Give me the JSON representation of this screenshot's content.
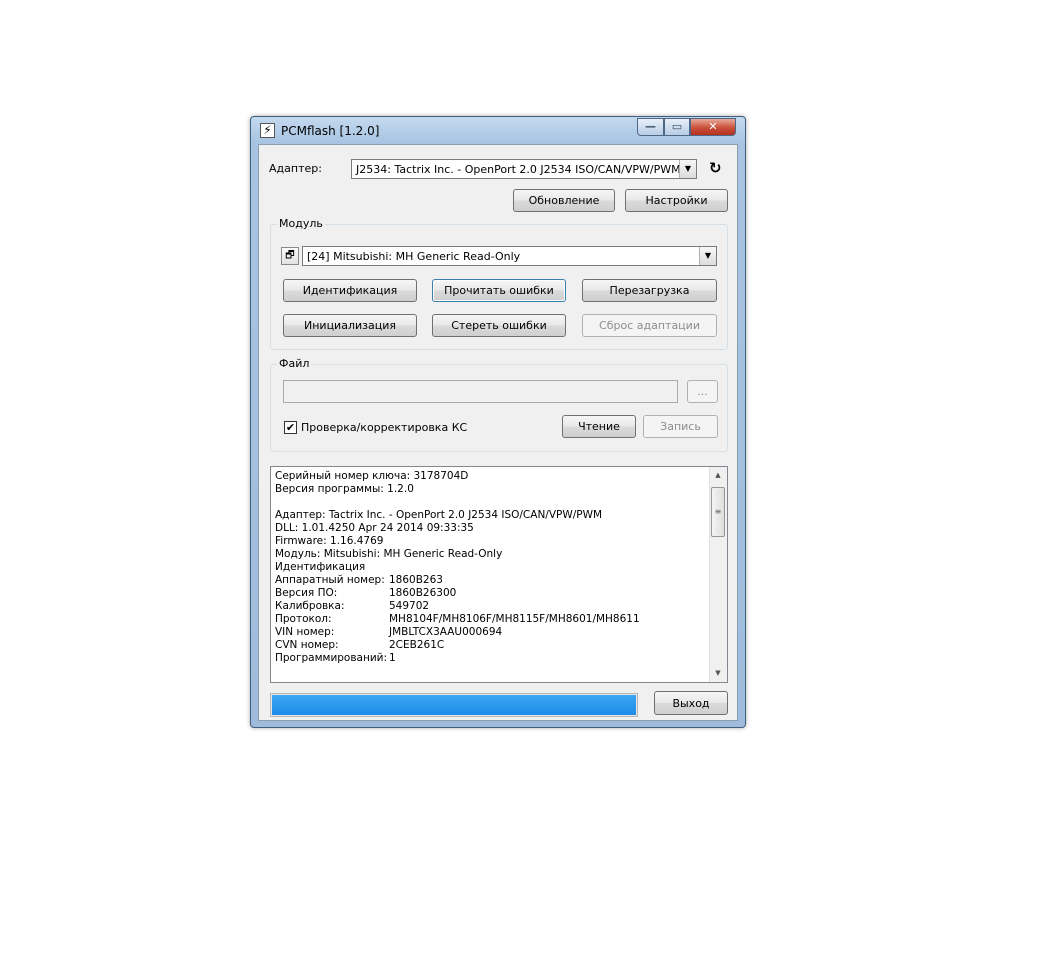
{
  "window": {
    "title": "PCMflash [1.2.0]",
    "minimize_glyph": "—",
    "maximize_glyph": "▭",
    "close_glyph": "✕"
  },
  "adapter": {
    "label": "Адаптер:",
    "value": "J2534: Tactrix Inc. - OpenPort 2.0 J2534 ISO/CAN/VPW/PWM",
    "refresh_icon": "refresh-icon"
  },
  "top_buttons": {
    "update": "Обновление",
    "settings": "Настройки"
  },
  "module": {
    "group_title": "Модуль",
    "value": "[24] Mitsubishi: MH Generic Read-Only",
    "buttons": {
      "identify": "Идентификация",
      "read_errors": "Прочитать ошибки",
      "reboot": "Перезагрузка",
      "init": "Инициализация",
      "clear_errors": "Стереть ошибки",
      "reset_adapt": "Сброс адаптации"
    }
  },
  "file": {
    "group_title": "Файл",
    "path_value": "",
    "browse": "...",
    "checksum_label": "Проверка/корректировка КС",
    "checksum_checked": true,
    "read": "Чтение",
    "write": "Запись"
  },
  "log": {
    "lines": [
      {
        "k": "Серийный номер ключа: 3178704D",
        "v": ""
      },
      {
        "k": "Версия программы: 1.2.0",
        "v": ""
      },
      {
        "k": "",
        "v": ""
      },
      {
        "k": "Адаптер: Tactrix Inc. - OpenPort 2.0 J2534 ISO/CAN/VPW/PWM",
        "v": ""
      },
      {
        "k": "DLL: 1.01.4250 Apr 24 2014 09:33:35",
        "v": ""
      },
      {
        "k": "Firmware: 1.16.4769",
        "v": ""
      },
      {
        "k": "Модуль: Mitsubishi: MH Generic Read-Only",
        "v": ""
      },
      {
        "k": "Идентификация",
        "v": ""
      },
      {
        "k": "Аппаратный номер:",
        "v": "1860B263"
      },
      {
        "k": "Версия ПО:",
        "v": "1860B26300"
      },
      {
        "k": "Калибровка:",
        "v": "549702"
      },
      {
        "k": "Протокол:",
        "v": "MH8104F/MH8106F/MH8115F/MH8601/MH8611"
      },
      {
        "k": "VIN номер:",
        "v": "JMBLTCX3AAU000694"
      },
      {
        "k": "CVN номер:",
        "v": "2CEB261C"
      },
      {
        "k": "Программирований:",
        "v": "1"
      }
    ]
  },
  "progress": {
    "value_percent": 100
  },
  "exit_button": "Выход",
  "colors": {
    "progress": "#1d8be8",
    "titlebar": "#a8c4e2"
  }
}
